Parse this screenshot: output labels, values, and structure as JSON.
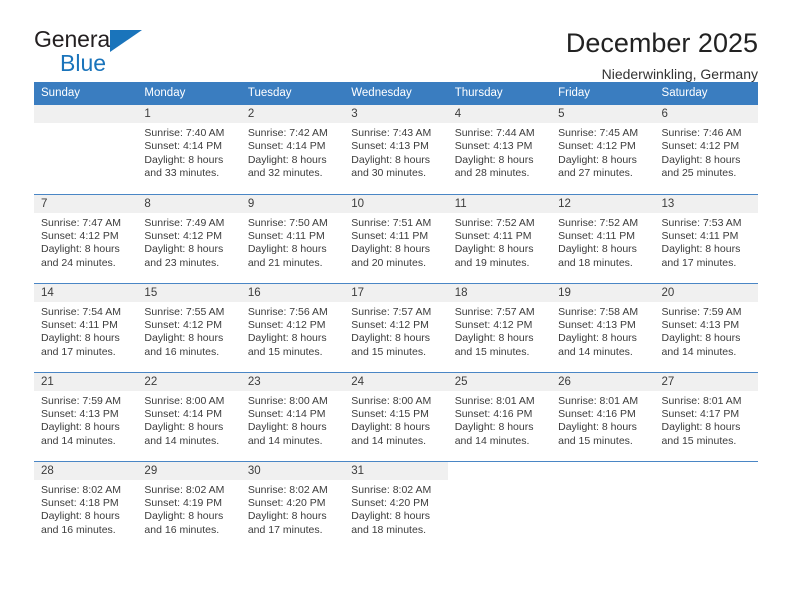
{
  "brand": {
    "name_top": "General",
    "name_bottom": "Blue",
    "accent_color": "#1a74bb"
  },
  "header": {
    "title": "December 2025",
    "subtitle": "Niederwinkling, Germany"
  },
  "calendar": {
    "header_color": "#3a7dc0",
    "daynum_band_color": "#f0f0f0",
    "weekday_headers": [
      "Sunday",
      "Monday",
      "Tuesday",
      "Wednesday",
      "Thursday",
      "Friday",
      "Saturday"
    ],
    "weeks": [
      [
        {
          "day": "",
          "sunrise": "",
          "sunset": "",
          "daylight_line1": "",
          "daylight_line2": ""
        },
        {
          "day": "1",
          "sunrise": "Sunrise: 7:40 AM",
          "sunset": "Sunset: 4:14 PM",
          "daylight_line1": "Daylight: 8 hours",
          "daylight_line2": "and 33 minutes."
        },
        {
          "day": "2",
          "sunrise": "Sunrise: 7:42 AM",
          "sunset": "Sunset: 4:14 PM",
          "daylight_line1": "Daylight: 8 hours",
          "daylight_line2": "and 32 minutes."
        },
        {
          "day": "3",
          "sunrise": "Sunrise: 7:43 AM",
          "sunset": "Sunset: 4:13 PM",
          "daylight_line1": "Daylight: 8 hours",
          "daylight_line2": "and 30 minutes."
        },
        {
          "day": "4",
          "sunrise": "Sunrise: 7:44 AM",
          "sunset": "Sunset: 4:13 PM",
          "daylight_line1": "Daylight: 8 hours",
          "daylight_line2": "and 28 minutes."
        },
        {
          "day": "5",
          "sunrise": "Sunrise: 7:45 AM",
          "sunset": "Sunset: 4:12 PM",
          "daylight_line1": "Daylight: 8 hours",
          "daylight_line2": "and 27 minutes."
        },
        {
          "day": "6",
          "sunrise": "Sunrise: 7:46 AM",
          "sunset": "Sunset: 4:12 PM",
          "daylight_line1": "Daylight: 8 hours",
          "daylight_line2": "and 25 minutes."
        }
      ],
      [
        {
          "day": "7",
          "sunrise": "Sunrise: 7:47 AM",
          "sunset": "Sunset: 4:12 PM",
          "daylight_line1": "Daylight: 8 hours",
          "daylight_line2": "and 24 minutes."
        },
        {
          "day": "8",
          "sunrise": "Sunrise: 7:49 AM",
          "sunset": "Sunset: 4:12 PM",
          "daylight_line1": "Daylight: 8 hours",
          "daylight_line2": "and 23 minutes."
        },
        {
          "day": "9",
          "sunrise": "Sunrise: 7:50 AM",
          "sunset": "Sunset: 4:11 PM",
          "daylight_line1": "Daylight: 8 hours",
          "daylight_line2": "and 21 minutes."
        },
        {
          "day": "10",
          "sunrise": "Sunrise: 7:51 AM",
          "sunset": "Sunset: 4:11 PM",
          "daylight_line1": "Daylight: 8 hours",
          "daylight_line2": "and 20 minutes."
        },
        {
          "day": "11",
          "sunrise": "Sunrise: 7:52 AM",
          "sunset": "Sunset: 4:11 PM",
          "daylight_line1": "Daylight: 8 hours",
          "daylight_line2": "and 19 minutes."
        },
        {
          "day": "12",
          "sunrise": "Sunrise: 7:52 AM",
          "sunset": "Sunset: 4:11 PM",
          "daylight_line1": "Daylight: 8 hours",
          "daylight_line2": "and 18 minutes."
        },
        {
          "day": "13",
          "sunrise": "Sunrise: 7:53 AM",
          "sunset": "Sunset: 4:11 PM",
          "daylight_line1": "Daylight: 8 hours",
          "daylight_line2": "and 17 minutes."
        }
      ],
      [
        {
          "day": "14",
          "sunrise": "Sunrise: 7:54 AM",
          "sunset": "Sunset: 4:11 PM",
          "daylight_line1": "Daylight: 8 hours",
          "daylight_line2": "and 17 minutes."
        },
        {
          "day": "15",
          "sunrise": "Sunrise: 7:55 AM",
          "sunset": "Sunset: 4:12 PM",
          "daylight_line1": "Daylight: 8 hours",
          "daylight_line2": "and 16 minutes."
        },
        {
          "day": "16",
          "sunrise": "Sunrise: 7:56 AM",
          "sunset": "Sunset: 4:12 PM",
          "daylight_line1": "Daylight: 8 hours",
          "daylight_line2": "and 15 minutes."
        },
        {
          "day": "17",
          "sunrise": "Sunrise: 7:57 AM",
          "sunset": "Sunset: 4:12 PM",
          "daylight_line1": "Daylight: 8 hours",
          "daylight_line2": "and 15 minutes."
        },
        {
          "day": "18",
          "sunrise": "Sunrise: 7:57 AM",
          "sunset": "Sunset: 4:12 PM",
          "daylight_line1": "Daylight: 8 hours",
          "daylight_line2": "and 15 minutes."
        },
        {
          "day": "19",
          "sunrise": "Sunrise: 7:58 AM",
          "sunset": "Sunset: 4:13 PM",
          "daylight_line1": "Daylight: 8 hours",
          "daylight_line2": "and 14 minutes."
        },
        {
          "day": "20",
          "sunrise": "Sunrise: 7:59 AM",
          "sunset": "Sunset: 4:13 PM",
          "daylight_line1": "Daylight: 8 hours",
          "daylight_line2": "and 14 minutes."
        }
      ],
      [
        {
          "day": "21",
          "sunrise": "Sunrise: 7:59 AM",
          "sunset": "Sunset: 4:13 PM",
          "daylight_line1": "Daylight: 8 hours",
          "daylight_line2": "and 14 minutes."
        },
        {
          "day": "22",
          "sunrise": "Sunrise: 8:00 AM",
          "sunset": "Sunset: 4:14 PM",
          "daylight_line1": "Daylight: 8 hours",
          "daylight_line2": "and 14 minutes."
        },
        {
          "day": "23",
          "sunrise": "Sunrise: 8:00 AM",
          "sunset": "Sunset: 4:14 PM",
          "daylight_line1": "Daylight: 8 hours",
          "daylight_line2": "and 14 minutes."
        },
        {
          "day": "24",
          "sunrise": "Sunrise: 8:00 AM",
          "sunset": "Sunset: 4:15 PM",
          "daylight_line1": "Daylight: 8 hours",
          "daylight_line2": "and 14 minutes."
        },
        {
          "day": "25",
          "sunrise": "Sunrise: 8:01 AM",
          "sunset": "Sunset: 4:16 PM",
          "daylight_line1": "Daylight: 8 hours",
          "daylight_line2": "and 14 minutes."
        },
        {
          "day": "26",
          "sunrise": "Sunrise: 8:01 AM",
          "sunset": "Sunset: 4:16 PM",
          "daylight_line1": "Daylight: 8 hours",
          "daylight_line2": "and 15 minutes."
        },
        {
          "day": "27",
          "sunrise": "Sunrise: 8:01 AM",
          "sunset": "Sunset: 4:17 PM",
          "daylight_line1": "Daylight: 8 hours",
          "daylight_line2": "and 15 minutes."
        }
      ],
      [
        {
          "day": "28",
          "sunrise": "Sunrise: 8:02 AM",
          "sunset": "Sunset: 4:18 PM",
          "daylight_line1": "Daylight: 8 hours",
          "daylight_line2": "and 16 minutes."
        },
        {
          "day": "29",
          "sunrise": "Sunrise: 8:02 AM",
          "sunset": "Sunset: 4:19 PM",
          "daylight_line1": "Daylight: 8 hours",
          "daylight_line2": "and 16 minutes."
        },
        {
          "day": "30",
          "sunrise": "Sunrise: 8:02 AM",
          "sunset": "Sunset: 4:20 PM",
          "daylight_line1": "Daylight: 8 hours",
          "daylight_line2": "and 17 minutes."
        },
        {
          "day": "31",
          "sunrise": "Sunrise: 8:02 AM",
          "sunset": "Sunset: 4:20 PM",
          "daylight_line1": "Daylight: 8 hours",
          "daylight_line2": "and 18 minutes."
        },
        {
          "day": "",
          "sunrise": "",
          "sunset": "",
          "daylight_line1": "",
          "daylight_line2": ""
        },
        {
          "day": "",
          "sunrise": "",
          "sunset": "",
          "daylight_line1": "",
          "daylight_line2": ""
        },
        {
          "day": "",
          "sunrise": "",
          "sunset": "",
          "daylight_line1": "",
          "daylight_line2": ""
        }
      ]
    ]
  }
}
